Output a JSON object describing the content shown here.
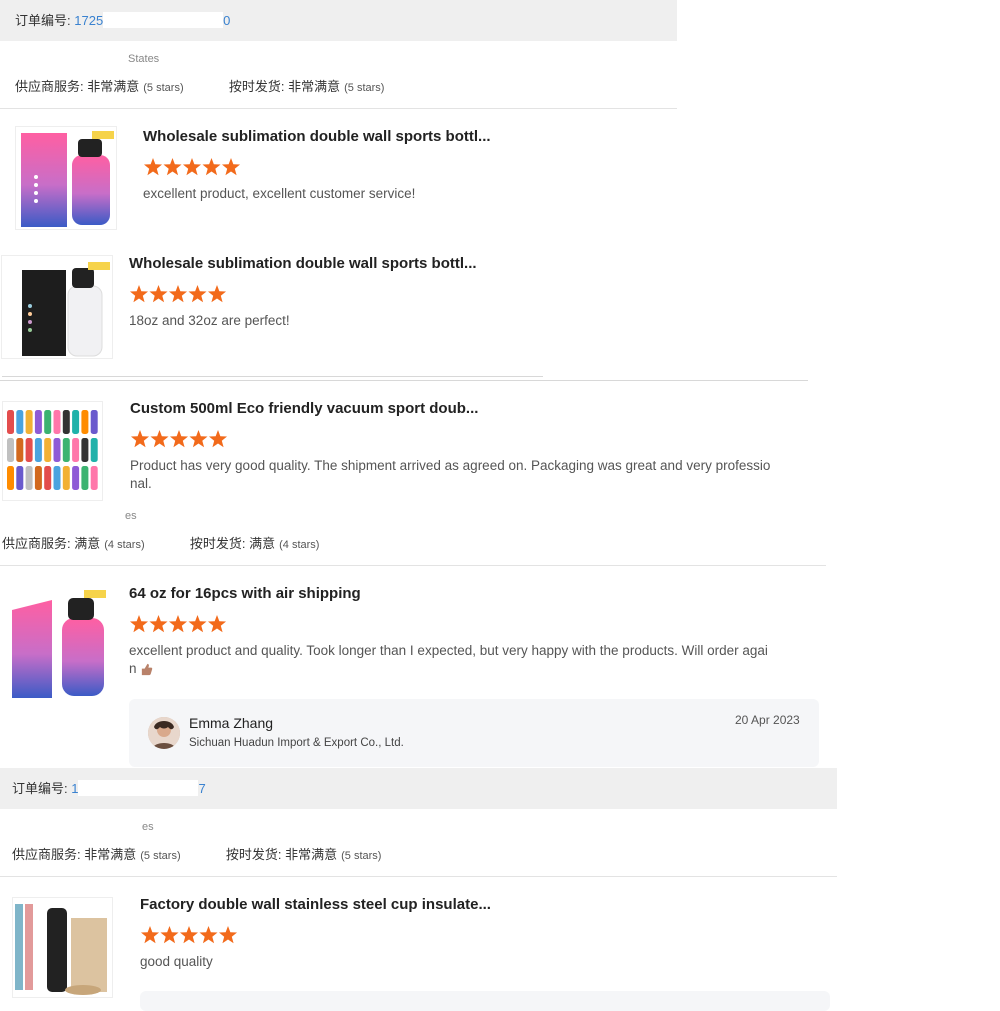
{
  "colors": {
    "accent": "#3a82d0",
    "star": "#f26a1b",
    "order_bar": "#efefef",
    "reply_bg": "#f5f6f8"
  },
  "order1": {
    "label": "订单编号:",
    "number_visible_start": "1725",
    "number_visible_end": "0",
    "country": "States",
    "supplier_service_label": "供应商服务:",
    "supplier_service_value": "非常满意",
    "supplier_service_stars": "(5 stars)",
    "on_time_label": "按时发货:",
    "on_time_value": "非常满意",
    "on_time_stars": "(5 stars)"
  },
  "order2": {
    "label": "订单编号:",
    "number_visible_start": "1",
    "number_visible_end": "7",
    "country": "es",
    "supplier_service_label": "供应商服务:",
    "supplier_service_value": "满意",
    "supplier_service_stars": "(4 stars)",
    "on_time_label": "按时发货:",
    "on_time_value": "满意",
    "on_time_stars": "(4 stars)"
  },
  "order3": {
    "label": "订单编号:",
    "number_visible_start": "1",
    "number_visible_end": "7",
    "country": "es",
    "supplier_service_label": "供应商服务:",
    "supplier_service_value": "非常满意",
    "supplier_service_stars": "(5 stars)",
    "on_time_label": "按时发货:",
    "on_time_value": "非常满意",
    "on_time_stars": "(5 stars)"
  },
  "reviews": [
    {
      "title": "Wholesale sublimation double wall sports bottl...",
      "rating": 5,
      "text": "excellent product, excellent customer service!"
    },
    {
      "title": "Wholesale sublimation double wall sports bottl...",
      "rating": 5,
      "text": "18oz and 32oz are perfect!"
    },
    {
      "title": "Custom 500ml Eco friendly vacuum sport doub...",
      "rating": 5,
      "text_line1": "Product has very good quality. The shipment arrived as agreed on. Packaging was great and very professio",
      "text_line2": "nal."
    },
    {
      "title": "64 oz for 16pcs with air shipping",
      "rating": 5,
      "text_line1": "excellent product and quality. Took longer than I expected, but very happy with the products. Will order agai",
      "text_line2": "n"
    },
    {
      "title": "Factory double wall stainless steel cup insulate...",
      "rating": 5,
      "text": "good quality"
    }
  ],
  "reply": {
    "name": "Emma Zhang",
    "company": "Sichuan Huadun Import & Export Co., Ltd.",
    "date": "20 Apr 2023"
  },
  "icons": {
    "star": "star-icon",
    "thumb_up": "thumbs-up-emoji",
    "avatar": "avatar"
  }
}
